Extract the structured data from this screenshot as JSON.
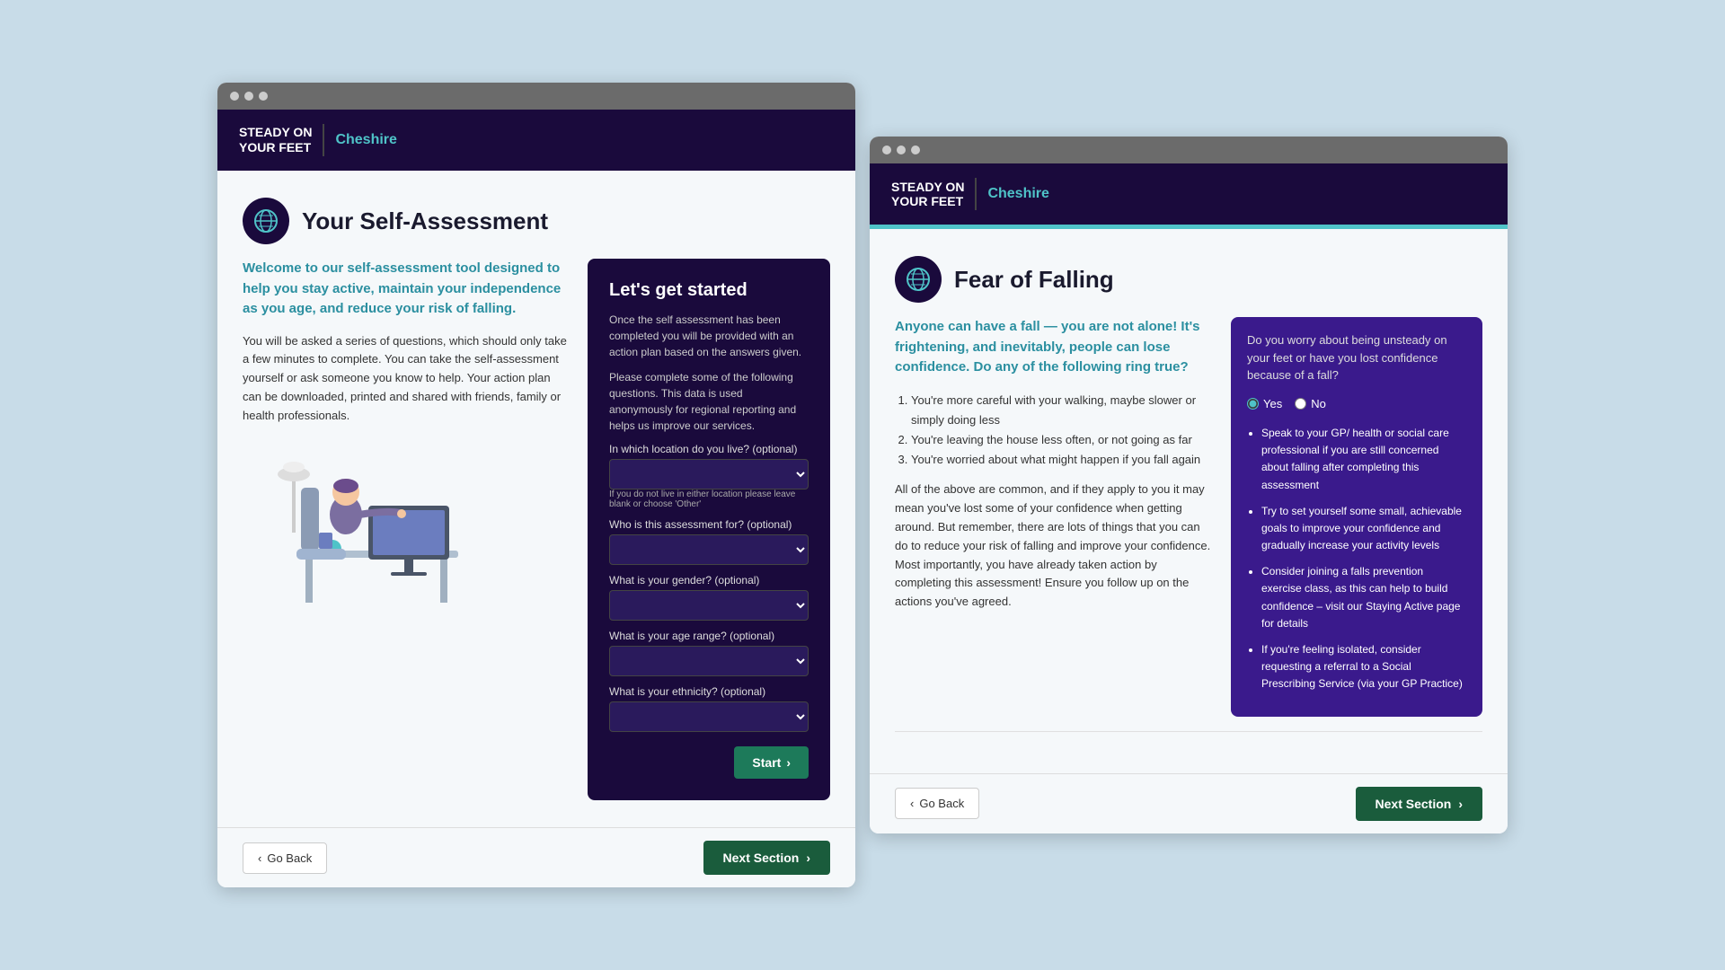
{
  "left_panel": {
    "browser_dots": [
      "dot1",
      "dot2",
      "dot3"
    ],
    "header": {
      "logo_line1": "STEADY ON",
      "logo_line2": "YOUR FEET",
      "region": "Cheshire"
    },
    "page": {
      "title": "Your Self-Assessment",
      "intro": "Welcome to our self-assessment tool designed to help you stay active, maintain your independence as you age, and reduce your risk of falling.",
      "body1": "You will be asked a series of questions, which should only take a few minutes to complete. You can take the self-assessment yourself or ask someone you know to help. Your action plan can be downloaded, printed and shared with friends, family or health professionals.",
      "form_card": {
        "title": "Let's get started",
        "desc1": "Once the self assessment has been completed you will be provided with an action plan based on the answers given.",
        "desc2": "Please complete some of the following questions. This data is used anonymously for regional reporting and helps us improve our services.",
        "fields": [
          {
            "label": "In which location do you live? (optional)",
            "hint": "If you do not live in either location please leave blank or choose 'Other'",
            "id": "location"
          },
          {
            "label": "Who is this assessment for? (optional)",
            "hint": "",
            "id": "for_whom"
          },
          {
            "label": "What is your gender? (optional)",
            "hint": "",
            "id": "gender"
          },
          {
            "label": "What is your age range? (optional)",
            "hint": "",
            "id": "age_range"
          },
          {
            "label": "What is your ethnicity? (optional)",
            "hint": "",
            "id": "ethnicity"
          }
        ],
        "start_button": "Start"
      }
    },
    "footer": {
      "go_back": "Go Back",
      "next_section": "Next Section"
    }
  },
  "right_panel": {
    "header": {
      "logo_line1": "STEADY ON",
      "logo_line2": "YOUR FEET",
      "region": "Cheshire"
    },
    "page": {
      "title": "Fear of Falling",
      "intro": "Anyone can have a fall — you are not alone! It's frightening, and inevitably, people can lose confidence. Do any of the following ring true?",
      "list_items": [
        "You're more careful with your walking, maybe slower or simply doing less",
        "You're leaving the house less often, or not going as far",
        "You're worried about what might happen if you fall again"
      ],
      "body": "All of the above are common, and if they apply to you it may mean you've lost some of your confidence when getting around. But remember, there are lots of things that you can do to reduce your risk of falling and improve your confidence. Most importantly, you have already taken action by completing this assessment! Ensure you follow up on the actions you've agreed.",
      "advice_card": {
        "question": "Do you worry about being unsteady on your feet or have you lost confidence because of a fall?",
        "yes_label": "Yes",
        "no_label": "No",
        "yes_checked": true,
        "advice_items": [
          "Speak to your GP/ health or social care professional if you are still concerned about falling after completing this assessment",
          "Try to set yourself some small, achievable goals to improve your confidence and gradually increase your activity levels",
          "Consider joining a falls prevention exercise class, as this can help to build confidence – visit our Staying Active page for details",
          "If you're feeling isolated, consider requesting a referral to a Social Prescribing Service (via your GP Practice)"
        ]
      }
    },
    "footer": {
      "go_back": "Go Back",
      "next_section": "Next Section"
    }
  }
}
